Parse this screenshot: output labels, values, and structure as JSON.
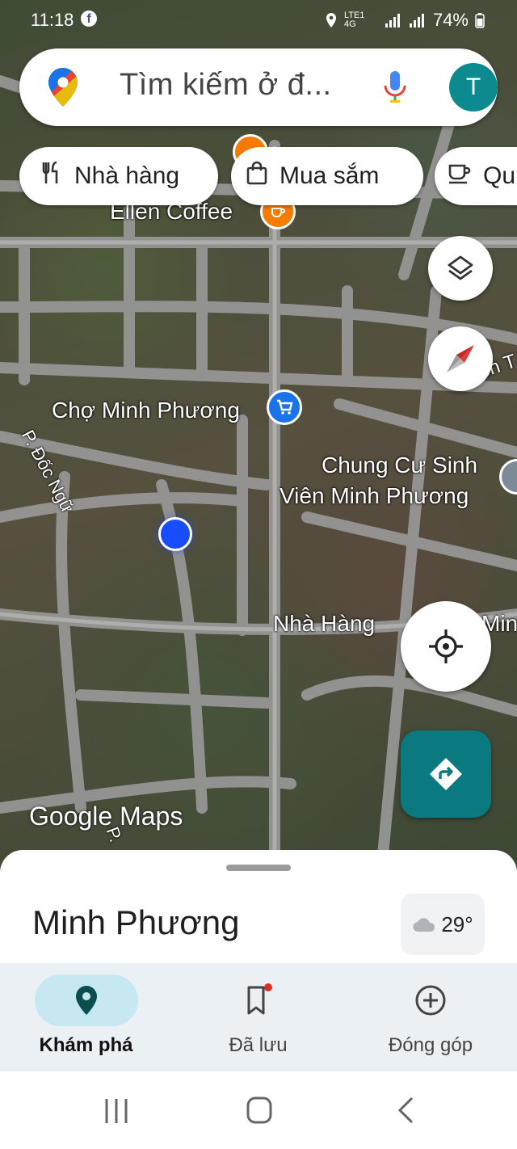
{
  "status_bar": {
    "time": "11:18",
    "app_icon": "facebook-icon",
    "battery": "74%",
    "signal": "LTE1 4G"
  },
  "search": {
    "placeholder": "Tìm kiếm ở đ...",
    "avatar_letter": "T"
  },
  "chips": [
    {
      "label": "Nhà hàng",
      "icon": "restaurant-icon"
    },
    {
      "label": "Mua sắm",
      "icon": "shopping-bag-icon"
    },
    {
      "label": "Qu",
      "icon": "coffee-icon"
    }
  ],
  "map": {
    "labels": {
      "ellen": "Ellen Coffee",
      "cho": "Chợ Minh Phương",
      "chungcu1": "Chung Cư Sinh",
      "chungcu2": "Viên Minh Phương",
      "nhahang": "Nhà Hàng",
      "nhahang_suffix": "Min",
      "docngu": "P. Đốc Ngữ",
      "street_p": "P.",
      "street_t": "ễn T"
    },
    "watermark": "Google Maps"
  },
  "colors": {
    "accent": "#0a7a80",
    "nav_active": "#c7e8f0",
    "poi_orange": "#f57c00",
    "poi_blue": "#1a73e8",
    "location_dot": "#1a4cff"
  },
  "sheet": {
    "place_name": "Minh Phương",
    "temperature": "29°"
  },
  "bottom_nav": [
    {
      "label": "Khám phá",
      "active": true
    },
    {
      "label": "Đã lưu",
      "active": false
    },
    {
      "label": "Đóng góp",
      "active": false
    }
  ]
}
